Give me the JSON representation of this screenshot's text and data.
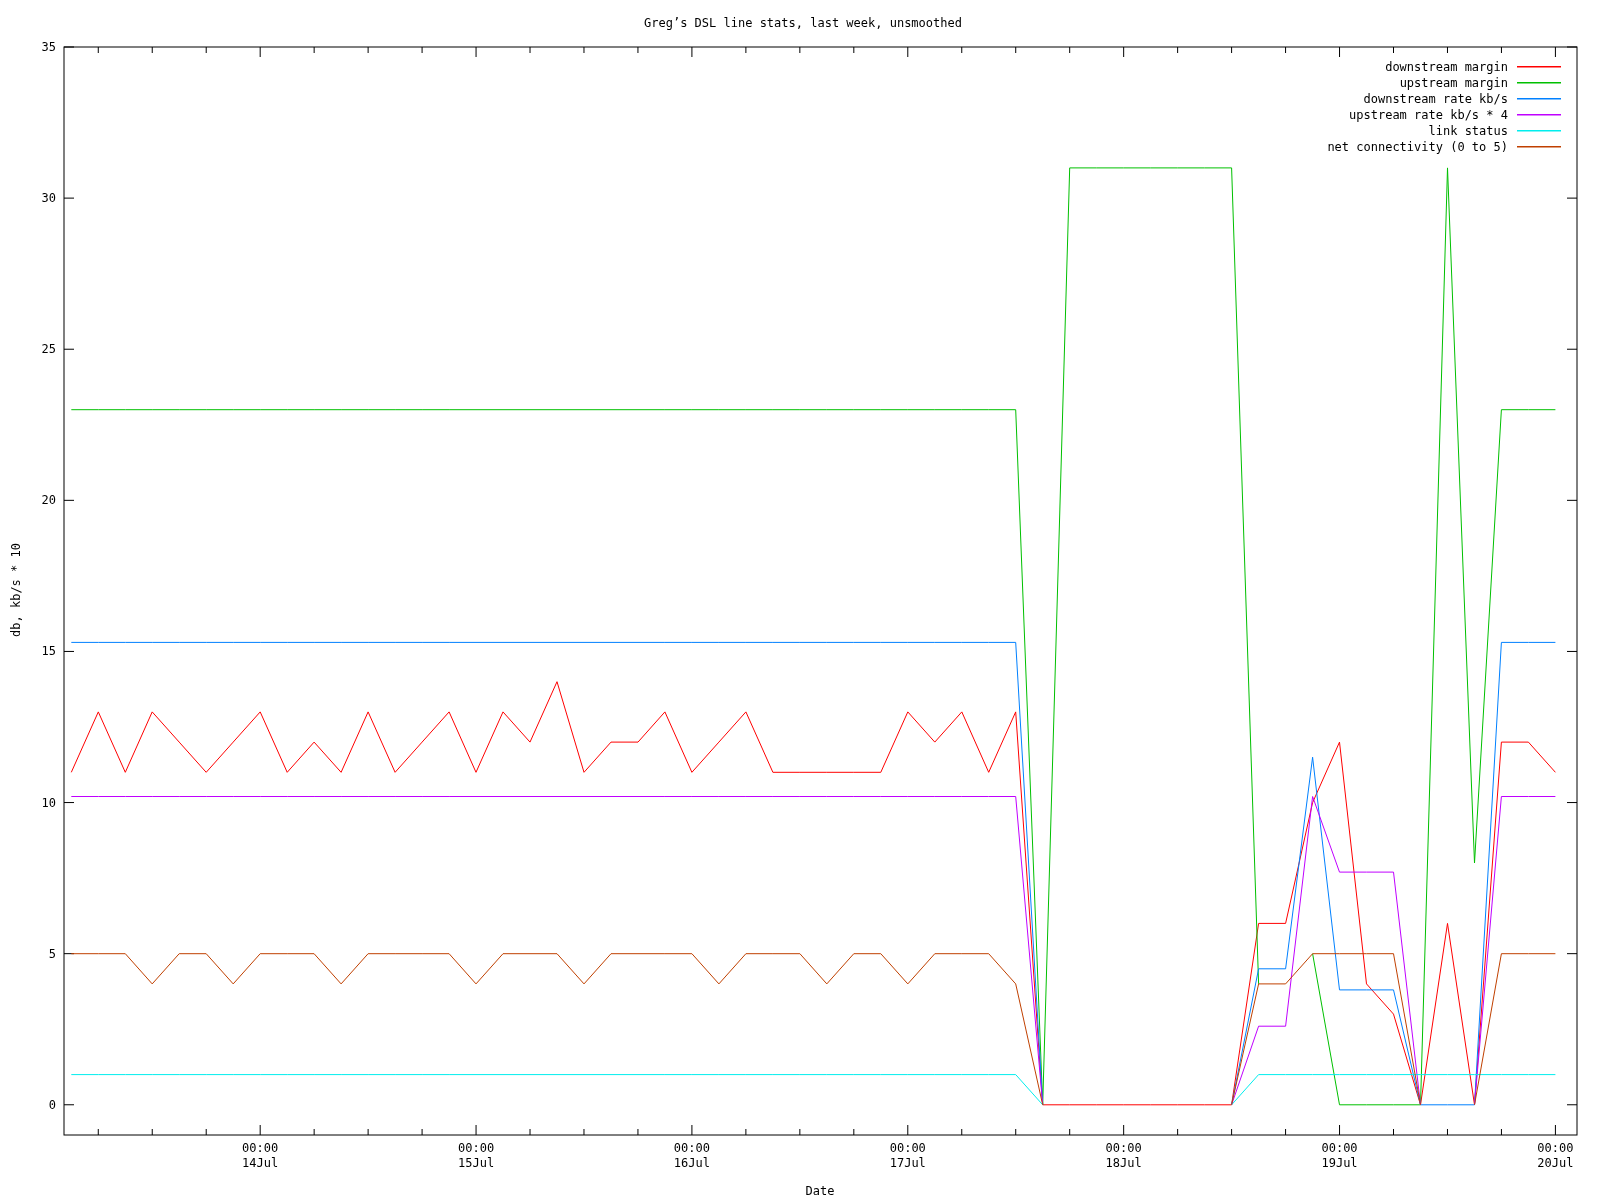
{
  "chart": {
    "chart_data": {
      "type": "line",
      "title": "Greg’s DSL line stats, last week, unsmoothed",
      "xlabel": "Date",
      "ylabel": "db, kb/s * 10",
      "categories": [
        null,
        null,
        null,
        null,
        null,
        null,
        null,
        "00:00 14Jul",
        null,
        null,
        null,
        null,
        null,
        null,
        null,
        "00:00 15Jul",
        null,
        null,
        null,
        null,
        null,
        null,
        null,
        "00:00 16Jul",
        null,
        null,
        null,
        null,
        null,
        null,
        null,
        "00:00 17Jul",
        null,
        null,
        null,
        null,
        null,
        null,
        null,
        "00:00 18Jul",
        null,
        null,
        null,
        null,
        null,
        null,
        null,
        "00:00 19Jul",
        null,
        null,
        null,
        null,
        null,
        null,
        null,
        "00:00 20Jul"
      ],
      "legend": "upper right",
      "ylim": [
        -1,
        35
      ],
      "yticks": [
        0,
        5,
        10,
        15,
        20,
        25,
        30,
        35
      ],
      "series": [
        {
          "name": "downstream margin",
          "color": "#ff0000",
          "values": [
            11,
            13,
            11,
            13,
            12,
            11,
            12,
            13,
            11,
            12,
            11,
            13,
            11,
            12,
            13,
            11,
            13,
            12,
            14,
            11,
            12,
            12,
            13,
            11,
            12,
            13,
            11,
            11,
            11,
            11,
            11,
            13,
            12,
            13,
            11,
            13,
            0,
            0,
            0,
            0,
            0,
            0,
            0,
            0,
            6,
            6,
            10,
            12,
            4,
            3,
            0,
            6,
            0,
            12,
            12,
            11
          ]
        },
        {
          "name": "upstream margin",
          "color": "#00c000",
          "values": [
            23,
            23,
            23,
            23,
            23,
            23,
            23,
            23,
            23,
            23,
            23,
            23,
            23,
            23,
            23,
            23,
            23,
            23,
            23,
            23,
            23,
            23,
            23,
            23,
            23,
            23,
            23,
            23,
            23,
            23,
            23,
            23,
            23,
            23,
            23,
            23,
            0,
            31,
            31,
            31,
            31,
            31,
            31,
            31,
            4,
            null,
            5,
            0,
            0,
            0,
            0,
            31,
            8,
            23,
            23,
            23
          ]
        },
        {
          "name": "downstream rate kb/s",
          "color": "#0080ff",
          "values": [
            15.3,
            15.3,
            15.3,
            15.3,
            15.3,
            15.3,
            15.3,
            15.3,
            15.3,
            15.3,
            15.3,
            15.3,
            15.3,
            15.3,
            15.3,
            15.3,
            15.3,
            15.3,
            15.3,
            15.3,
            15.3,
            15.3,
            15.3,
            15.3,
            15.3,
            15.3,
            15.3,
            15.3,
            15.3,
            15.3,
            15.3,
            15.3,
            15.3,
            15.3,
            15.3,
            15.3,
            0,
            null,
            null,
            null,
            null,
            null,
            null,
            0,
            4.5,
            4.5,
            11.5,
            3.8,
            3.8,
            3.8,
            0,
            0,
            0,
            15.3,
            15.3,
            15.3
          ]
        },
        {
          "name": "upstream rate kb/s * 4",
          "color": "#c000ff",
          "values": [
            10.2,
            10.2,
            10.2,
            10.2,
            10.2,
            10.2,
            10.2,
            10.2,
            10.2,
            10.2,
            10.2,
            10.2,
            10.2,
            10.2,
            10.2,
            10.2,
            10.2,
            10.2,
            10.2,
            10.2,
            10.2,
            10.2,
            10.2,
            10.2,
            10.2,
            10.2,
            10.2,
            10.2,
            10.2,
            10.2,
            10.2,
            10.2,
            10.2,
            10.2,
            10.2,
            10.2,
            0,
            null,
            null,
            null,
            null,
            null,
            null,
            0,
            2.6,
            2.6,
            10.2,
            7.7,
            7.7,
            7.7,
            0,
            null,
            0,
            10.2,
            10.2,
            10.2
          ]
        },
        {
          "name": "link status",
          "color": "#00eeee",
          "values": [
            1,
            1,
            1,
            1,
            1,
            1,
            1,
            1,
            1,
            1,
            1,
            1,
            1,
            1,
            1,
            1,
            1,
            1,
            1,
            1,
            1,
            1,
            1,
            1,
            1,
            1,
            1,
            1,
            1,
            1,
            1,
            1,
            1,
            1,
            1,
            1,
            0,
            null,
            null,
            null,
            null,
            null,
            null,
            0,
            1,
            1,
            1,
            1,
            1,
            1,
            1,
            1,
            1,
            1,
            1,
            1
          ]
        },
        {
          "name": "net connectivity (0 to 5)",
          "color": "#c04000",
          "values": [
            5,
            5,
            5,
            4,
            5,
            5,
            4,
            5,
            5,
            5,
            4,
            5,
            5,
            5,
            5,
            4,
            5,
            5,
            5,
            4,
            5,
            5,
            5,
            5,
            4,
            5,
            5,
            5,
            4,
            5,
            5,
            4,
            5,
            5,
            5,
            4,
            0,
            null,
            null,
            null,
            null,
            null,
            null,
            0,
            4,
            4,
            5,
            5,
            5,
            5,
            0,
            null,
            0,
            5,
            5,
            5
          ]
        }
      ]
    }
  }
}
